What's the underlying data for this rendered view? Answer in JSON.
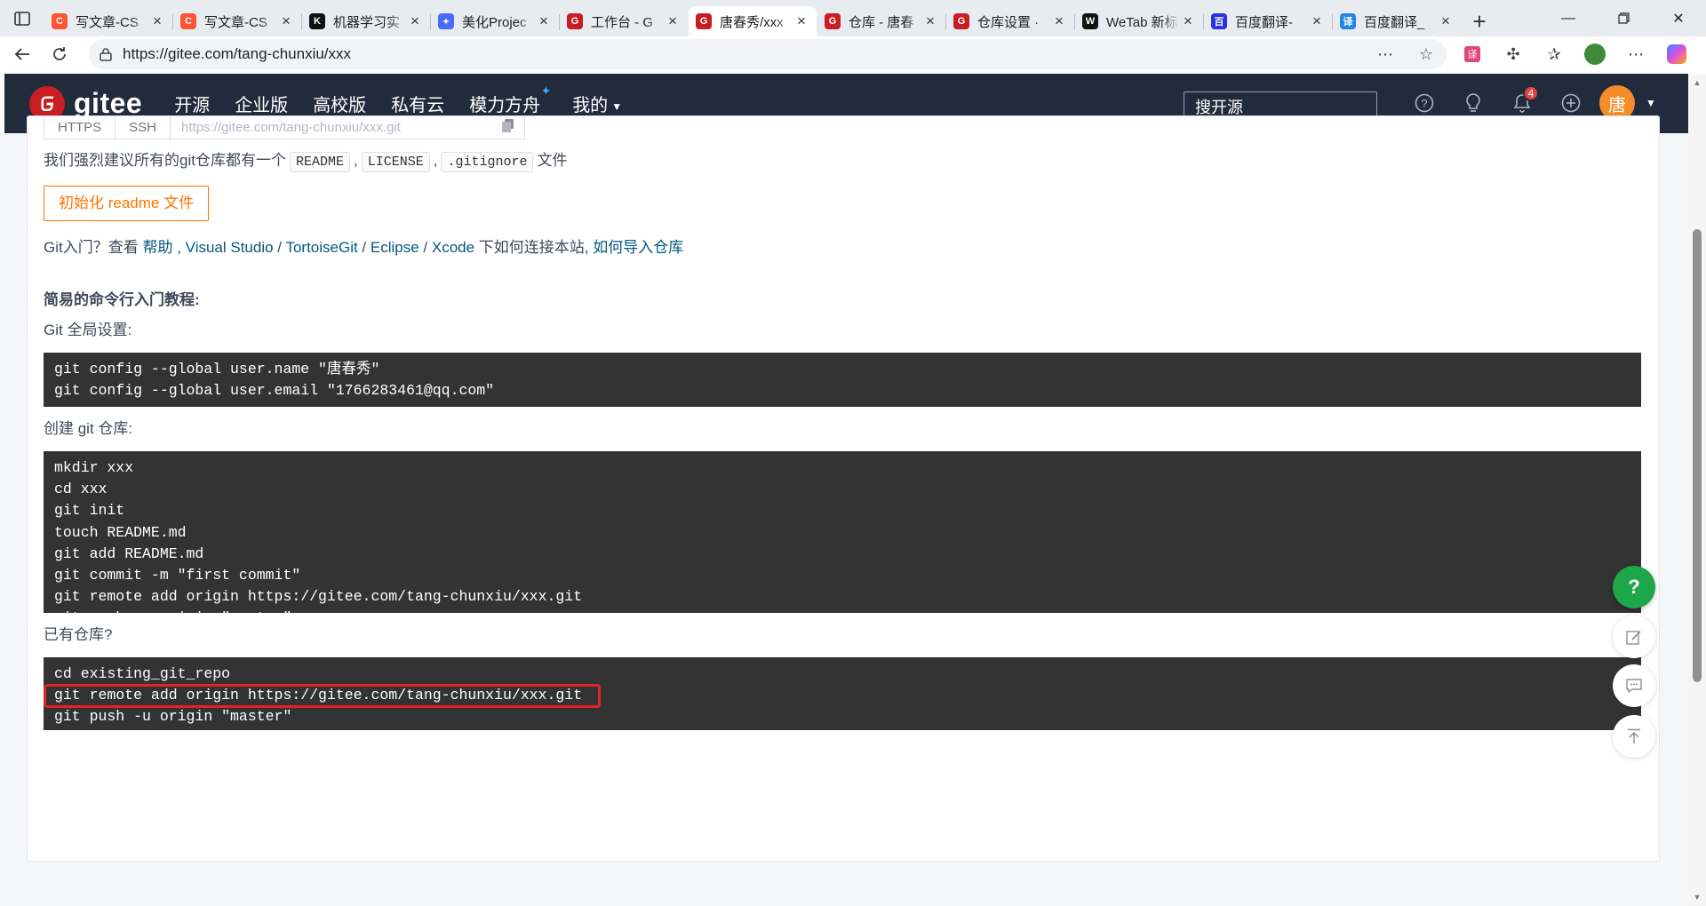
{
  "browser": {
    "tabs": [
      {
        "title": "写文章-CS",
        "favicon": "csdn-icon",
        "color": "#fc5531",
        "glyph": "C"
      },
      {
        "title": "写文章-CS",
        "favicon": "csdn-icon",
        "color": "#fc5531",
        "glyph": "C"
      },
      {
        "title": "机器学习实",
        "favicon": "k-icon",
        "color": "#111111",
        "glyph": "K"
      },
      {
        "title": "美化Projec",
        "favicon": "wing-icon",
        "color": "#4a6cf7",
        "glyph": "✦"
      },
      {
        "title": "工作台 - G",
        "favicon": "gitee-icon",
        "color": "#c71d23",
        "glyph": "G"
      },
      {
        "title": "唐春秀/xxx",
        "favicon": "gitee-icon",
        "color": "#c71d23",
        "glyph": "G",
        "active": true
      },
      {
        "title": "仓库 - 唐春",
        "favicon": "gitee-icon",
        "color": "#c71d23",
        "glyph": "G"
      },
      {
        "title": "仓库设置 ·",
        "favicon": "gitee-icon",
        "color": "#c71d23",
        "glyph": "G"
      },
      {
        "title": "WeTab 新标",
        "favicon": "wetab-icon",
        "color": "#111111",
        "glyph": "W"
      },
      {
        "title": "百度翻译-",
        "favicon": "baidu-icon",
        "color": "#2932e1",
        "glyph": "百"
      },
      {
        "title": "百度翻译_",
        "favicon": "translate-icon",
        "color": "#1e88e5",
        "glyph": "译"
      }
    ],
    "url": "https://gitee.com/tang-chunxiu/xxx"
  },
  "gitee": {
    "logo_text": "gitee",
    "nav": [
      "开源",
      "企业版",
      "高校版",
      "私有云",
      "模力方舟",
      "我的"
    ],
    "search_placeholder": "搜开源",
    "notification_count": "4",
    "avatar_char": "唐"
  },
  "clone": {
    "https_label": "HTTPS",
    "ssh_label": "SSH",
    "url": "https://gitee.com/tang-chunxiu/xxx.git"
  },
  "content": {
    "suggest_prefix": "我们强烈建议所有的git仓库都有一个",
    "files": [
      "README",
      "LICENSE",
      ".gitignore"
    ],
    "suggest_suffix": "文件",
    "init_button": "初始化 readme 文件",
    "git_intro_prefix": "Git入门？查看",
    "help_link": "帮助",
    "tools": [
      "Visual Studio",
      "TortoiseGit",
      "Eclipse",
      "Xcode"
    ],
    "connect_text": "下如何连接本站,",
    "import_link": "如何导入仓库",
    "tutorial_title": "简易的命令行入门教程:",
    "global_title": "Git 全局设置:",
    "global_cmds": "git config --global user.name \"唐春秀\"\ngit config --global user.email \"1766283461@qq.com\"",
    "create_title": "创建 git 仓库:",
    "create_cmds": "mkdir xxx\ncd xxx\ngit init\ntouch README.md\ngit add README.md\ngit commit -m \"first commit\"\ngit remote add origin https://gitee.com/tang-chunxiu/xxx.git\ngit push -u origin \"master\"",
    "existing_title": "已有仓库?",
    "existing_cmds": "cd existing_git_repo\ngit remote add origin https://gitee.com/tang-chunxiu/xxx.git\ngit push -u origin \"master\""
  },
  "floating": {
    "help_label": "?"
  },
  "colors": {
    "highlight": "#e32424",
    "accent": "#fe7300",
    "header_bg": "#222b3c",
    "code_bg": "#333333"
  }
}
